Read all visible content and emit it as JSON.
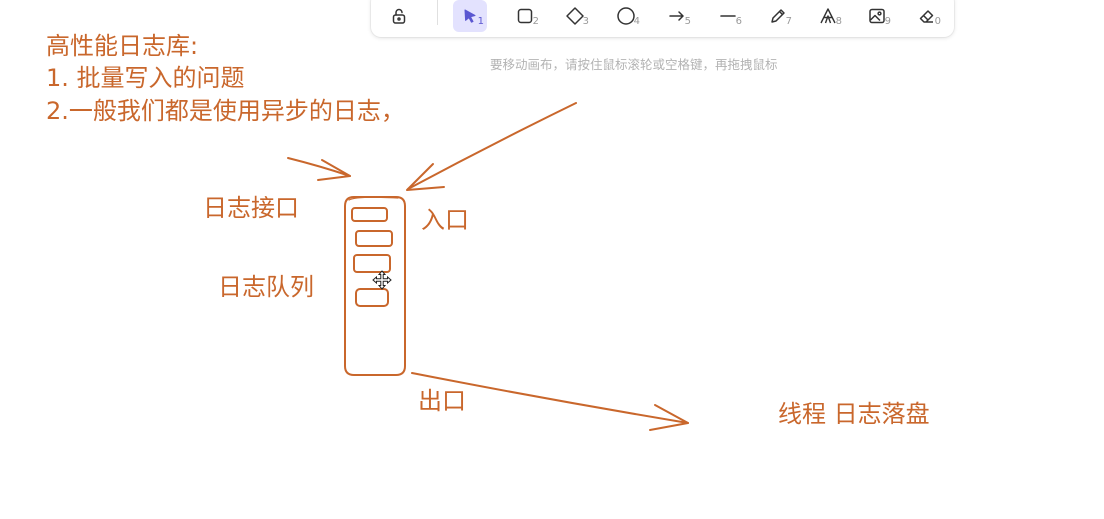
{
  "colors": {
    "ink": "#c9672c",
    "selected_bg": "#e3e2fe",
    "selected_fg": "#5b57d1",
    "hint": "#b3b3b3"
  },
  "toolbar": {
    "lock": {
      "icon": "unlock-icon"
    },
    "tools": [
      {
        "icon": "pointer-icon",
        "key": "1",
        "selected": true
      },
      {
        "icon": "rectangle-icon",
        "key": "2"
      },
      {
        "icon": "diamond-icon",
        "key": "3"
      },
      {
        "icon": "ellipse-icon",
        "key": "4"
      },
      {
        "icon": "arrow-icon",
        "key": "5"
      },
      {
        "icon": "line-icon",
        "key": "6"
      },
      {
        "icon": "pencil-icon",
        "key": "7"
      },
      {
        "icon": "text-icon",
        "key": "8"
      },
      {
        "icon": "image-icon",
        "key": "9"
      },
      {
        "icon": "eraser-icon",
        "key": "0"
      }
    ]
  },
  "hint_text": "要移动画布，请按住鼠标滚轮或空格键，再拖拽鼠标",
  "notes": {
    "line1": "高性能日志库:",
    "line2": "1. 批量写入的问题",
    "line3": "2.一般我们都是使用异步的日志，"
  },
  "labels": {
    "log_interface": "日志接口",
    "entry": "入口",
    "log_queue": "日志队列",
    "exit": "出口",
    "thread_flush": "线程  日志落盘"
  }
}
